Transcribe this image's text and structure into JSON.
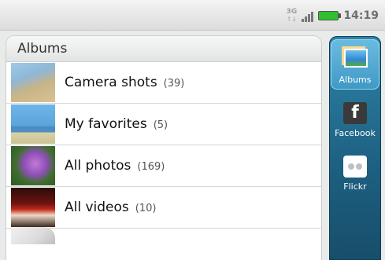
{
  "status_bar": {
    "network": "3G",
    "time": "14:19"
  },
  "albums_panel": {
    "title": "Albums",
    "rows": [
      {
        "label": "Camera shots",
        "count": "(39)"
      },
      {
        "label": "My favorites",
        "count": "(5)"
      },
      {
        "label": "All photos",
        "count": "(169)"
      },
      {
        "label": "All videos",
        "count": "(10)"
      }
    ]
  },
  "side_tabs": [
    {
      "label": "Albums",
      "icon": "albums-icon",
      "selected": true
    },
    {
      "label": "Facebook",
      "icon": "facebook-icon",
      "glyph": "f"
    },
    {
      "label": "Flickr",
      "icon": "flickr-icon"
    }
  ],
  "colors": {
    "tab_bar": "#1d5f80",
    "tab_selected": "#4aa3d0",
    "battery": "#2fbf2f"
  }
}
